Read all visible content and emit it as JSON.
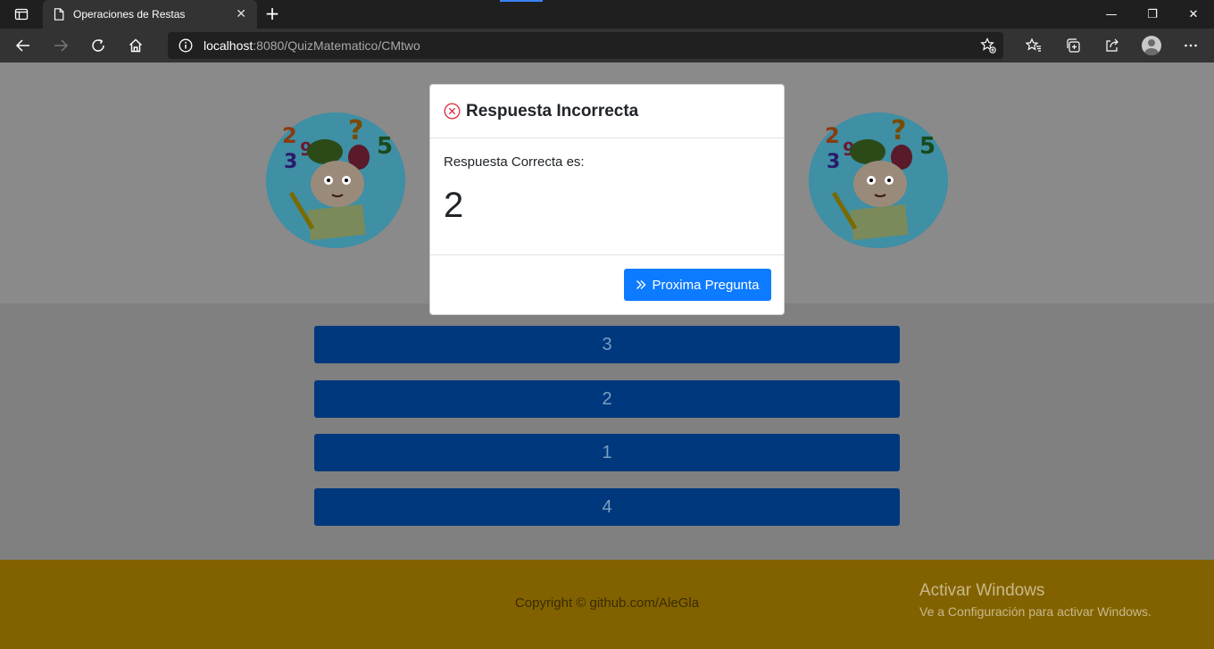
{
  "browser": {
    "tab_title": "Operaciones de Restas",
    "new_tab": "+",
    "url_host": "localhost",
    "url_path": ":8080/QuizMatematico/CMtwo",
    "window_controls": {
      "minimize": "—",
      "restore": "❐",
      "close": "✕"
    },
    "icons": [
      "back-icon",
      "forward-icon",
      "refresh-icon",
      "home-icon",
      "info-icon",
      "add-favorite-icon",
      "favorites-icon",
      "collections-icon",
      "share-icon",
      "profile-avatar",
      "more-icon"
    ]
  },
  "quiz": {
    "options": [
      "3",
      "2",
      "1",
      "4"
    ]
  },
  "modal": {
    "title": "Respuesta Incorrecta",
    "label": "Respuesta Correcta es:",
    "correct_answer": "2",
    "next_button": "Proxima Pregunta",
    "status_color": "#dc3545",
    "button_color": "#0d7bff"
  },
  "footer": {
    "copyright": "Copyright © github.com/AleGla"
  },
  "watermark": {
    "title": "Activar Windows",
    "subtitle": "Ve a Configuración para activar Windows."
  },
  "colors": {
    "footer": "#826200",
    "answer_button": "#00387d",
    "backdrop": "#808080"
  }
}
